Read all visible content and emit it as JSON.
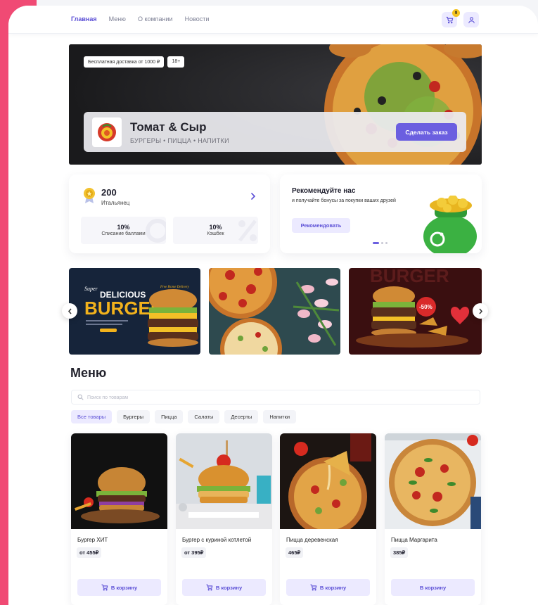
{
  "nav": {
    "items": [
      {
        "label": "Главная",
        "active": true
      },
      {
        "label": "Меню"
      },
      {
        "label": "О компании"
      },
      {
        "label": "Новости"
      }
    ],
    "cart_count": "9"
  },
  "hero": {
    "tags": [
      "Бесплатная доставка от 1000 ₽",
      "18+"
    ],
    "title": "Томат & Сыр",
    "subtitle": "БУРГЕРЫ • ПИЦЦА • НАПИТКИ",
    "order_button": "Сделать заказ"
  },
  "loyalty": {
    "points": "200",
    "rank": "Итальянец",
    "stats": [
      {
        "value": "10%",
        "label": "Списание баллами"
      },
      {
        "value": "10%",
        "label": "Кэшбек"
      }
    ]
  },
  "referral": {
    "title": "Рекомендуйте нас",
    "subtitle": "и получайте бонусы за покупки ваших друзей",
    "button": "Рекомендовать"
  },
  "promo_slides": {
    "slide1_text": [
      "Super",
      "DELICIOUS",
      "BURGER",
      "Free Home Delivery"
    ],
    "slide3_text": [
      "BURGER",
      "-50%"
    ]
  },
  "menu": {
    "title": "Меню",
    "search_placeholder": "Поиск по товарам",
    "categories": [
      "Все товары",
      "Бургеры",
      "Пицца",
      "Салаты",
      "Десерты",
      "Напитки"
    ],
    "products": [
      {
        "name": "Бургер ХИТ",
        "price": "от 455₽",
        "button": "В корзину"
      },
      {
        "name": "Бургер с куриной котлетой",
        "price": "от 395₽",
        "button": "В корзину"
      },
      {
        "name": "Пицца деревенская",
        "price": "465₽",
        "button": "В корзину"
      },
      {
        "name": "Пицца Маргарита",
        "price": "385₽",
        "button": "В корзину"
      }
    ]
  },
  "colors": {
    "accent": "#6b5fe0",
    "brand_pink": "#f04a74",
    "light_accent": "#eceaff"
  }
}
